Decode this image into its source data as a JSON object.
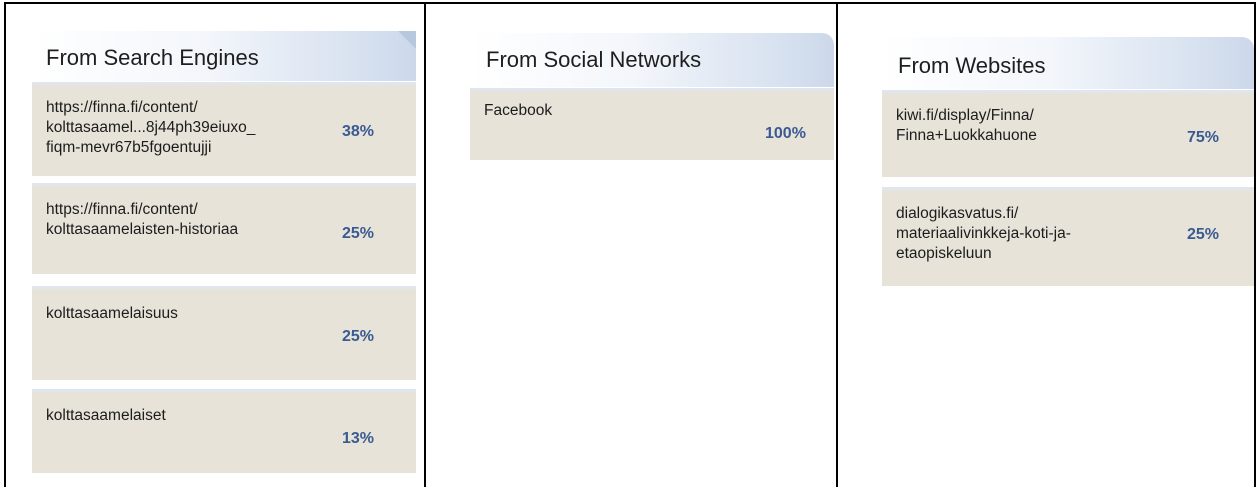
{
  "panels": {
    "search": {
      "title": "From Search Engines",
      "items": [
        {
          "label": "https://finna.fi/content/\nkolttasaamel...8j44ph39eiuxo_\nfiqm-mevr67b5fgoentujji",
          "value": "38%"
        },
        {
          "label": "https://finna.fi/content/\nkolttasaamelaisten-historiaa",
          "value": "25%"
        },
        {
          "label": "kolttasaamelaisuus",
          "value": "25%"
        },
        {
          "label": "kolttasaamelaiset",
          "value": "13%"
        }
      ]
    },
    "social": {
      "title": "From Social Networks",
      "items": [
        {
          "label": "Facebook",
          "value": "100%"
        }
      ]
    },
    "websites": {
      "title": "From Websites",
      "items": [
        {
          "label": "kiwi.fi/display/Finna/\nFinna+Luokkahuone",
          "value": "75%"
        },
        {
          "label": "dialogikasvatus.fi/\nmateriaalivinkkeja-koti-ja-\netaopiskeluun",
          "value": "25%"
        }
      ]
    }
  },
  "colors": {
    "item_bg": "#e7e3d8",
    "value_text": "#3a5a93",
    "header_gradient_end": "#ccd8ea"
  }
}
